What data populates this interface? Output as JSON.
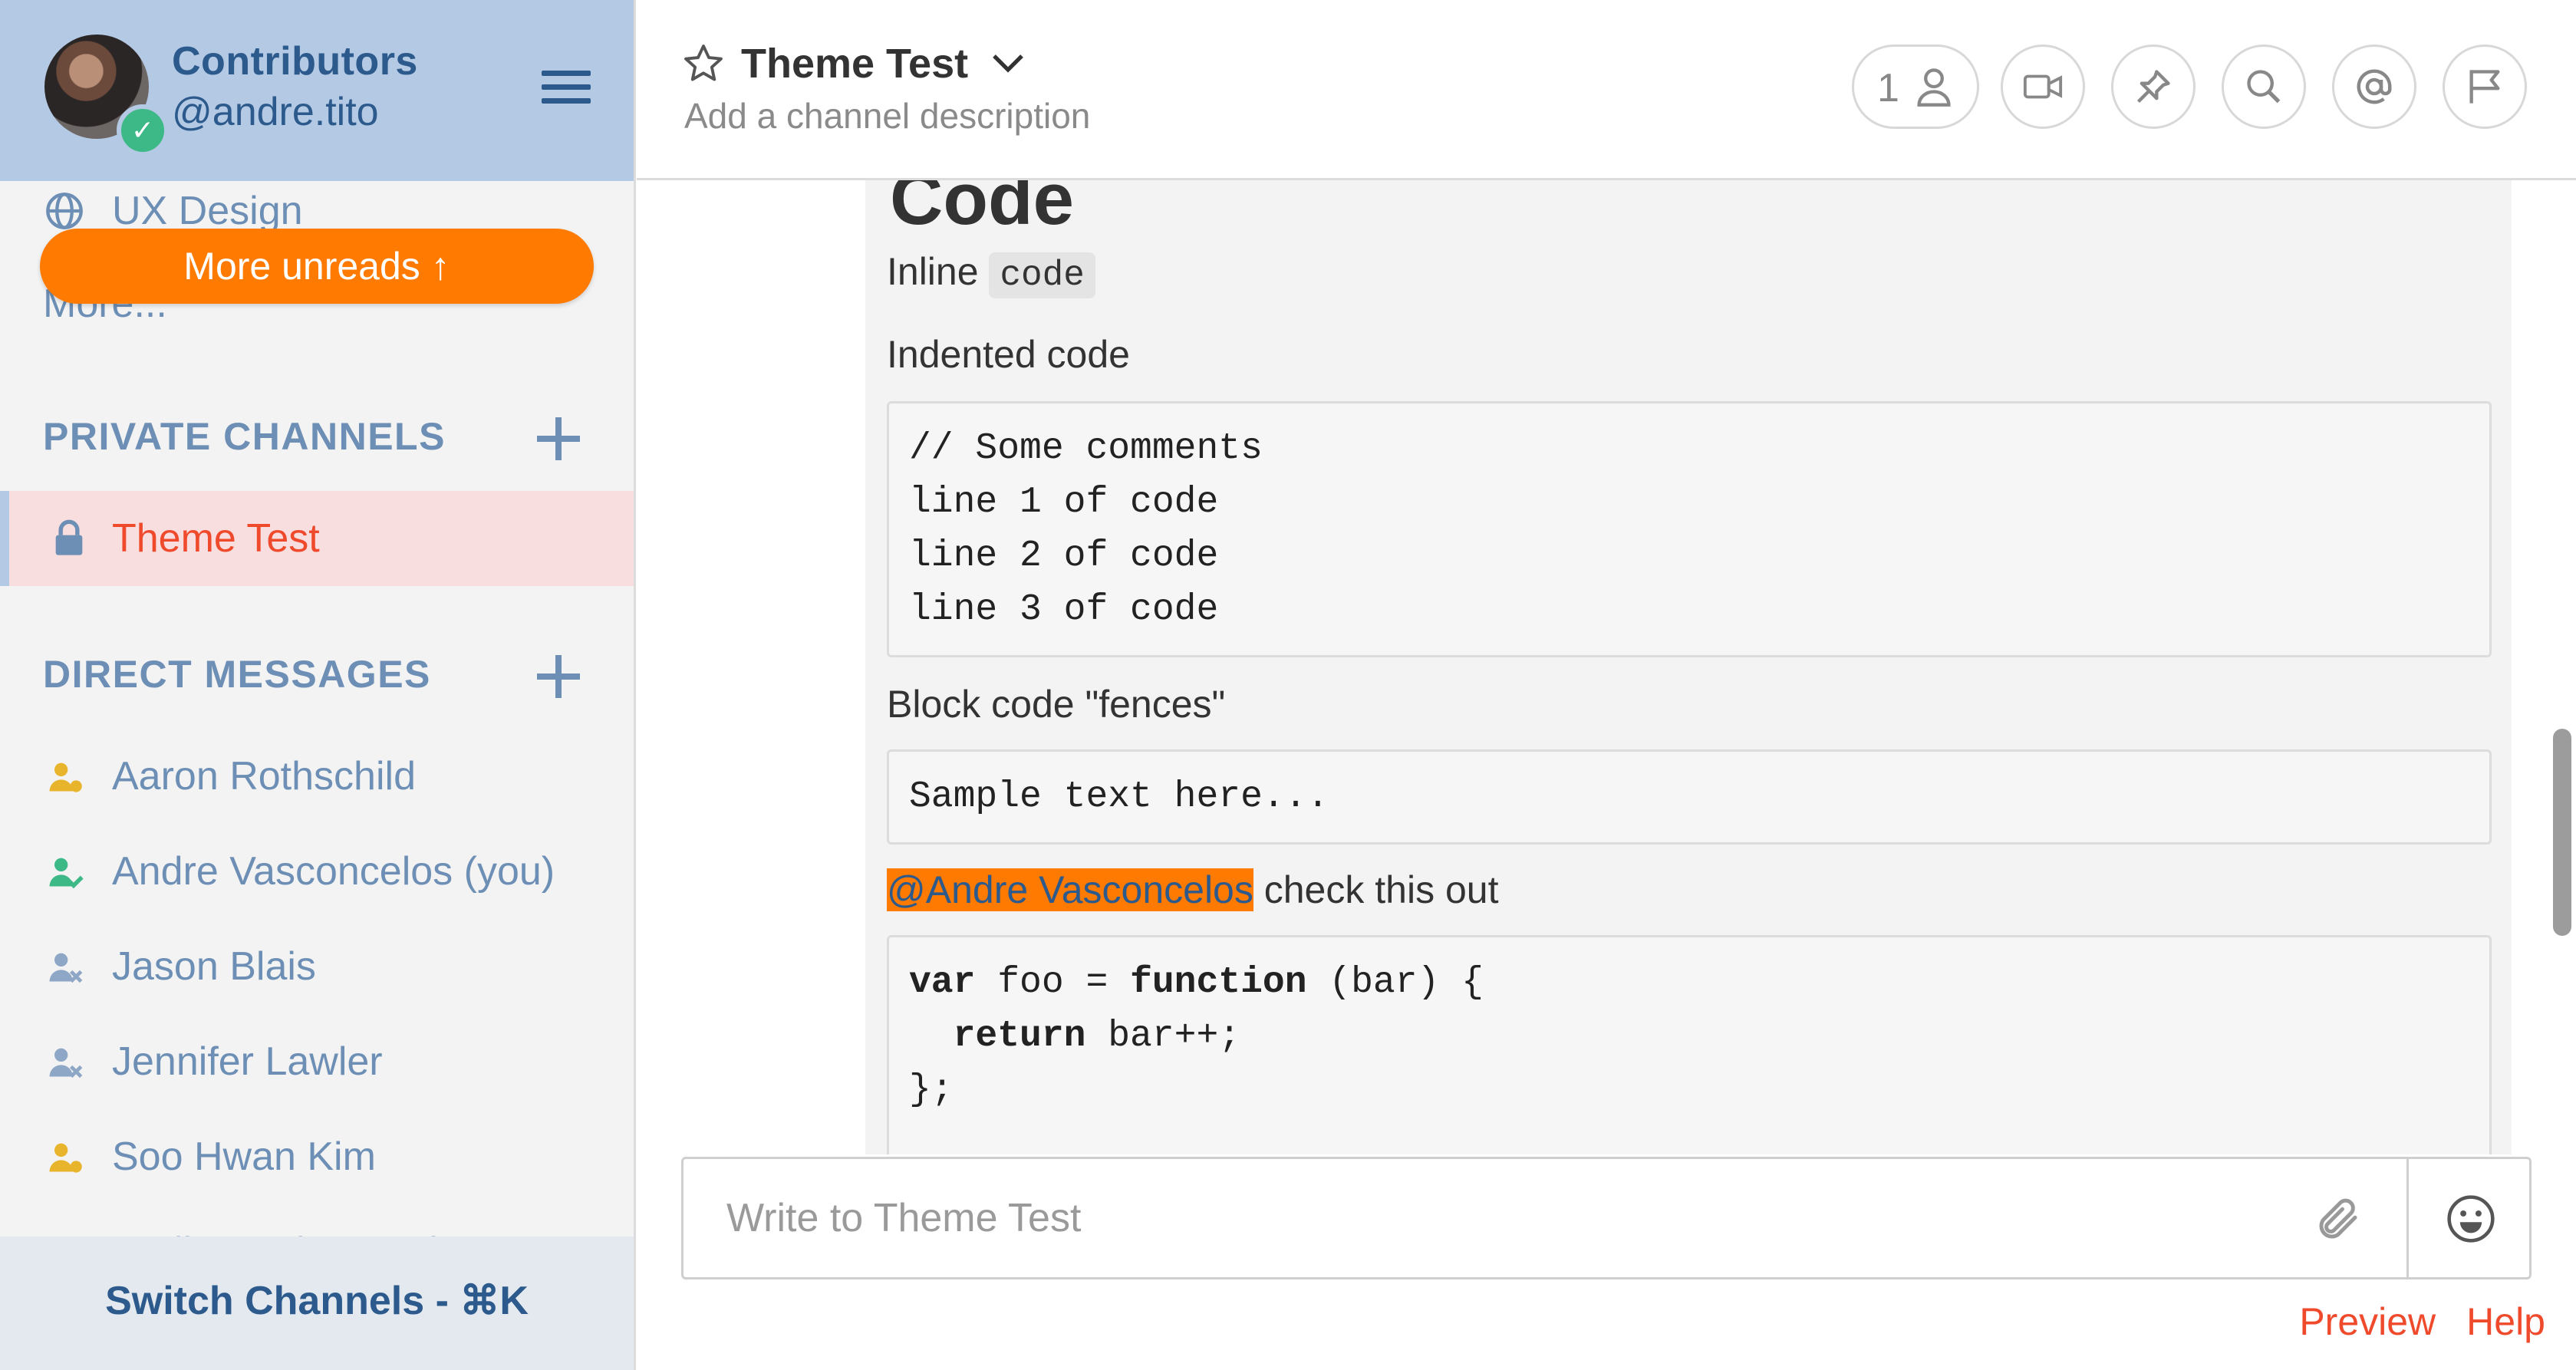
{
  "sidebar": {
    "team_name": "Contributors",
    "username": "@andre.tito",
    "ux_item": "UX Design",
    "more_link": "More...",
    "more_unreads": "More unreads ↑",
    "private_section": "PRIVATE CHANNELS",
    "active_channel": "Theme Test",
    "dm_section": "DIRECT MESSAGES",
    "dms": [
      {
        "name": "Aaron Rothschild",
        "status": "away",
        "color": "#e8b42c"
      },
      {
        "name": "Andre Vasconcelos (you)",
        "status": "online",
        "color": "#3db887"
      },
      {
        "name": "Jason Blais",
        "status": "offline",
        "color": "#8fa7c6"
      },
      {
        "name": "Jennifer Lawler",
        "status": "offline",
        "color": "#8fa7c6"
      },
      {
        "name": "Soo Hwan Kim",
        "status": "away",
        "color": "#e8b42c"
      },
      {
        "name": "Sudheer Timmaraju",
        "status": "away",
        "color": "#e8b42c"
      }
    ],
    "switch_channels": "Switch Channels - ⌘K"
  },
  "header": {
    "title": "Theme Test",
    "description": "Add a channel description",
    "member_count": "1",
    "icons": [
      "member-icon",
      "video-icon",
      "pin-icon",
      "search-icon",
      "mention-icon",
      "flag-icon"
    ]
  },
  "post": {
    "heading_fragment": "Code",
    "inline_prefix": "Inline ",
    "inline_code": "code",
    "indented_label": "Indented code",
    "indented_code": "// Some comments\nline 1 of code\nline 2 of code\nline 3 of code",
    "fences_label": "Block code \"fences\"",
    "fenced_code": "Sample text here...",
    "mention": "@Andre Vasconcelos",
    "mention_suffix": " check this out",
    "js_line1_kw": "var",
    "js_line1_mid": " foo = ",
    "js_line1_kw2": "function",
    "js_line1_end": " (bar) {",
    "js_line2_kw": "return",
    "js_line2_end": " bar++;",
    "js_line3": "};"
  },
  "composer": {
    "placeholder": "Write to Theme Test",
    "preview": "Preview",
    "help": "Help"
  },
  "colors": {
    "accent": "#ff7a00",
    "sidebar_header": "#b4c9e4",
    "link": "#ef4a2c",
    "sidebar_text": "#6d8fb5"
  }
}
